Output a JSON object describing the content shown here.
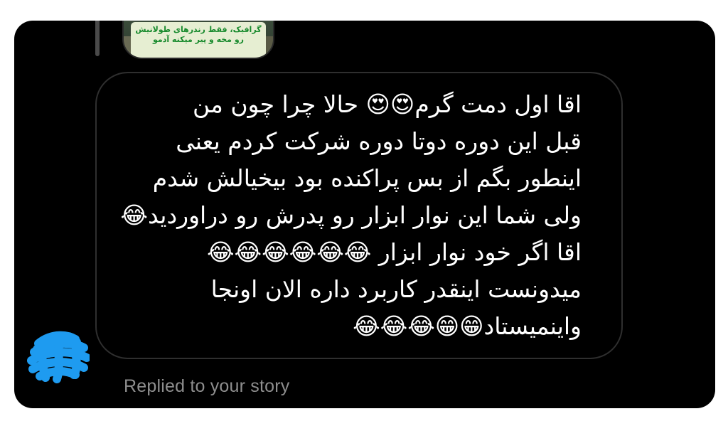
{
  "story_preview": {
    "caption_line_1": "گرافیک، فقط رندرهای طولانیش",
    "caption_line_2": "رو مخه و پیر میکنه آدمو"
  },
  "message": {
    "lines": [
      "اقا اول دمت گرم😍😍 حالا چرا چون من",
      "قبل این دوره دوتا دوره شرکت کردم یعنی",
      "اینطور بگم از بس پراکنده بود بیخیالش شدم",
      "ولی شما این نوار ابزار رو پدرش رو دراوردید😂",
      "اقا اگر خود نوار ابزار 😂😂😂😂😂😂",
      "میدونست اینقدر کاربرد داره الان اونجا",
      "واینمیستاد😁😁😂😂😂"
    ]
  },
  "footer": {
    "status": "Replied to your story"
  },
  "colors": {
    "background": "#000000",
    "bubble_border": "#2f2f2f",
    "message_text": "#ffffff",
    "status_text": "#8e8e8e",
    "avatar_scribble": "#1e9bf0"
  },
  "icons": {
    "avatar": "redacted-avatar-scribble"
  }
}
